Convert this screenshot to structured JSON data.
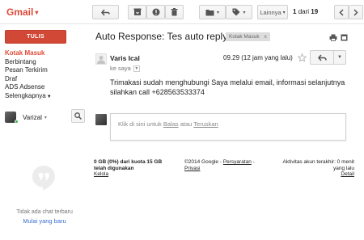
{
  "app": {
    "logo": "Gmail"
  },
  "toolbar": {
    "more_label": "Lainnya",
    "page_position": "1",
    "page_of": "dari",
    "page_total": "19",
    "icons": [
      "back-arrow-icon",
      "archive-icon",
      "report-spam-icon",
      "delete-icon",
      "folder-icon",
      "label-icon",
      "chevron-left-icon",
      "chevron-right-icon"
    ]
  },
  "sidebar": {
    "compose_label": "TULIS",
    "items": [
      {
        "label": "Kotak Masuk",
        "active": true
      },
      {
        "label": "Berbintang",
        "active": false
      },
      {
        "label": "Pesan Terkirim",
        "active": false
      },
      {
        "label": "Draf",
        "active": false
      },
      {
        "label": "ADS Adsense",
        "active": false
      },
      {
        "label": "Selengkapnya",
        "active": false
      }
    ],
    "chat_user": "Varizal",
    "no_chat_text": "Tidak ada chat terbaru",
    "start_chat_link": "Mulai yang baru"
  },
  "thread": {
    "subject": "Auto Response: Tes auto reply",
    "label_chip": "Kotak Masuk",
    "label_chip_close": "x"
  },
  "message": {
    "sender": "Varis Ical",
    "to": "ke saya",
    "timestamp": "09.29 (12 jam yang lalu)",
    "body": "Trimakasi sudah menghubungi Saya melalui email, informasi selanjutnya silahkan call +628563533374"
  },
  "reply": {
    "prompt_prefix": "Klik di sini untuk",
    "reply_link": "Balas",
    "prompt_mid": "atau",
    "forward_link": "Teruskan"
  },
  "footer": {
    "quota_line1": "0 GB (0%) dari kuota 15 GB",
    "quota_line2": "telah digunakan",
    "manage_link": "Kelola",
    "copyright": "©2014 Google -",
    "terms_link": "Persyaratan",
    "terms_sep": "-",
    "privacy_link": "Privasi",
    "activity_line1": "Aktivitas akun terakhir: 0 menit",
    "activity_line2": "yang lalu",
    "details_link": "Detail"
  },
  "colors": {
    "brand_red": "#dd4b39",
    "compose_red": "#d14836",
    "link_blue": "#3a6fd0",
    "online_green": "#3ab54a"
  }
}
